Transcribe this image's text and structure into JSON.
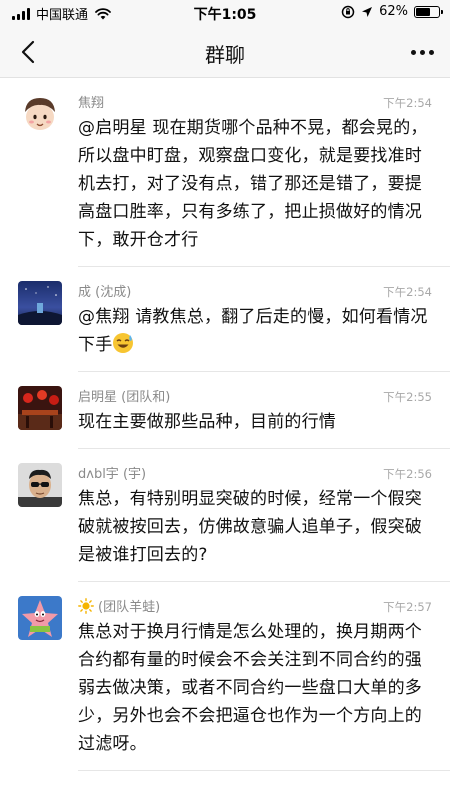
{
  "status_bar": {
    "carrier": "中国联通",
    "time": "下午1:05",
    "battery_percent_text": "62%",
    "battery_level": 0.62
  },
  "nav": {
    "title": "群聊",
    "back_icon": "chevron-left-icon",
    "more_icon": "more-dots-icon"
  },
  "messages": [
    {
      "name": "焦翔",
      "time": "下午2:54",
      "text": "@启明星 现在期货哪个品种不晃，都会晃的，所以盘中盯盘，观察盘口变化，就是要找准时机去打，对了没有点，错了那还是错了，要提高盘口胜率，只有多练了，把止损做好的情况下，敢开仓才行"
    },
    {
      "name": "成 (沈成)",
      "time": "下午2:54",
      "text": "@焦翔 请教焦总，翻了后走的慢，如何看情况下手",
      "emoji": "sweat-smile-emoji"
    },
    {
      "name": "启明星 (团队和)",
      "time": "下午2:55",
      "text": "现在主要做那些品种，目前的行情"
    },
    {
      "name": "dʌbl宇 (宇)",
      "time": "下午2:56",
      "text": "焦总，有特别明显突破的时候，经常一个假突破就被按回去，仿佛故意骗人追单子，假突破是被谁打回去的?"
    },
    {
      "name": "(团队羊蛙)",
      "name_icon": "sun-emoji",
      "time": "下午2:57",
      "text": "焦总对于换月行情是怎么处理的，换月期两个合约都有量的时候会不会关注到不同合约的强弱去做决策，或者不同合约一些盘口大单的多少，另外也会不会把逼仓也作为一个方向上的过滤呀。"
    }
  ]
}
